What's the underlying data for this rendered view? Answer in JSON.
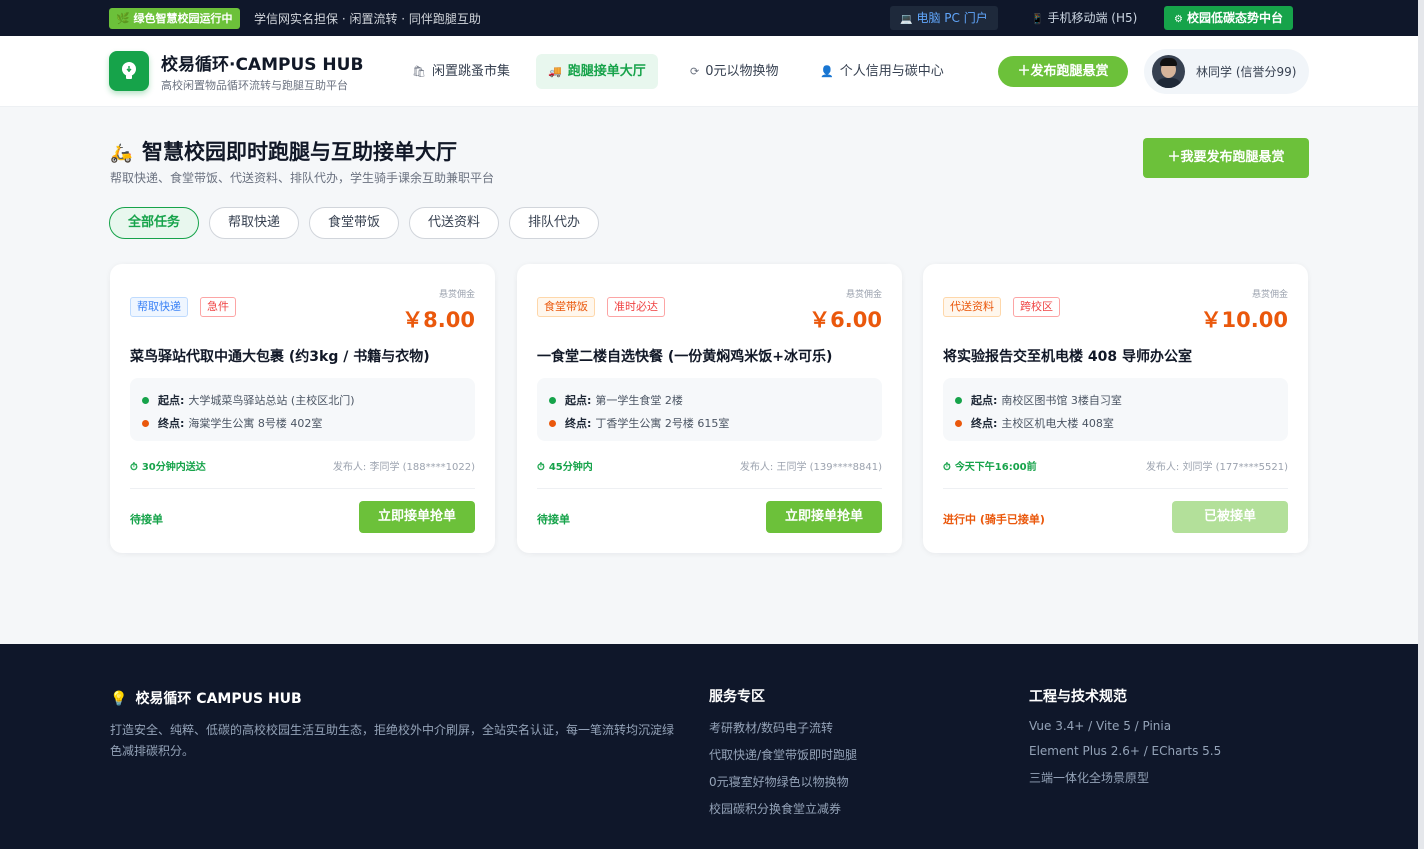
{
  "topbar": {
    "badge": "绿色智慧校园运行中",
    "notice": "学信网实名担保 · 闲置流转 · 同伴跑腿互助",
    "pc_label": "电脑 PC 门户",
    "h5_label": "手机移动端 (H5)",
    "dash_label": "校园低碳态势中台"
  },
  "header": {
    "brand": "校易循环·CAMPUS HUB",
    "brand_sub": "高校闲置物品循环流转与跑腿互助平台",
    "nav": [
      "闲置跳蚤市集",
      "跑腿接单大厅",
      "0元以物换物",
      "个人信用与碳中心"
    ],
    "publish_label": "发布跑腿悬赏",
    "user_label": "林同学 (信誉分99)"
  },
  "page": {
    "title": "智慧校园即时跑腿与互助接单大厅",
    "subtitle": "帮取快递、食堂带饭、代送资料、排队代办，学生骑手课余互助兼职平台",
    "publish_label": "我要发布跑腿悬赏",
    "filters": [
      "全部任务",
      "帮取快递",
      "食堂带饭",
      "代送资料",
      "排队代办"
    ],
    "active_filter": "全部任务"
  },
  "tasks": [
    {
      "tags": [
        "帮取快递",
        "急件"
      ],
      "reward_label": "悬赏佣金",
      "reward": "￥8.00",
      "title": "菜鸟驿站代取中通大包裹 (约3kg / 书籍与衣物)",
      "start_label": "起点:",
      "start": "大学城菜鸟驿站总站 (主校区北门)",
      "end_label": "终点:",
      "end": "海棠学生公寓 8号楼 402室",
      "deadline": "30分钟内送达",
      "publisher": "发布人: 李同学 (188****1022)",
      "status": "待接单",
      "action": "立即接单抢单",
      "action_enabled": true
    },
    {
      "tags": [
        "食堂带饭",
        "准时必达"
      ],
      "reward_label": "悬赏佣金",
      "reward": "￥6.00",
      "title": "一食堂二楼自选快餐 (一份黄焖鸡米饭+冰可乐)",
      "start_label": "起点:",
      "start": "第一学生食堂 2楼",
      "end_label": "终点:",
      "end": "丁香学生公寓 2号楼 615室",
      "deadline": "45分钟内",
      "publisher": "发布人: 王同学 (139****8841)",
      "status": "待接单",
      "action": "立即接单抢单",
      "action_enabled": true
    },
    {
      "tags": [
        "代送资料",
        "跨校区"
      ],
      "reward_label": "悬赏佣金",
      "reward": "￥10.00",
      "title": "将实验报告交至机电楼 408 导师办公室",
      "start_label": "起点:",
      "start": "南校区图书馆 3楼自习室",
      "end_label": "终点:",
      "end": "主校区机电大楼 408室",
      "deadline": "今天下午16:00前",
      "publisher": "发布人: 刘同学 (177****5521)",
      "status": "进行中 (骑手已接单)",
      "action": "已被接单",
      "action_enabled": false
    }
  ],
  "footer": {
    "brand": "校易循环 CAMPUS HUB",
    "desc": "打造安全、纯粹、低碳的高校校园生活互助生态，拒绝校外中介刷屏，全站实名认证，每一笔流转均沉淀绿色减排碳积分。",
    "col1_title": "服务专区",
    "col1_links": [
      "考研教材/数码电子流转",
      "代取快递/食堂带饭即时跑腿",
      "0元寝室好物绿色以物换物",
      "校园碳积分换食堂立减券"
    ],
    "col2_title": "工程与技术规范",
    "col2_links": [
      "Vue 3.4+ / Vite 5 / Pinia",
      "Element Plus 2.6+ / ECharts 5.5",
      "三端一体化全场景原型"
    ]
  },
  "colors": {
    "primary": "#16a34a",
    "accent_button": "#6cc13a",
    "reward": "#ea580c",
    "dark_bg": "#0f172a"
  }
}
